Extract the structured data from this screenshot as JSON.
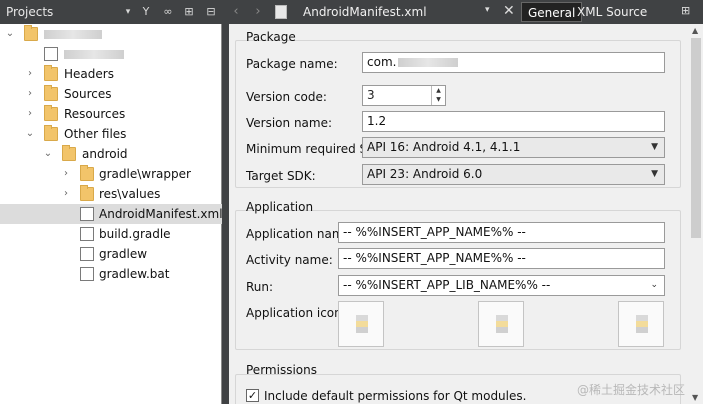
{
  "projects_pane": {
    "title": "Projects",
    "toolbar_icons": [
      "filter-icon",
      "link-icon",
      "split-icon",
      "close-pane-icon"
    ],
    "tree": {
      "root_label": "",
      "pro_file_label": "",
      "headers": "Headers",
      "sources": "Sources",
      "resources": "Resources",
      "other_files": "Other files",
      "android": "android",
      "gradle_wrapper": "gradle\\wrapper",
      "res_values": "res\\values",
      "manifest": "AndroidManifest.xml",
      "build_gradle": "build.gradle",
      "gradlew": "gradlew",
      "gradlew_bat": "gradlew.bat"
    }
  },
  "editor_tabs": {
    "document": "AndroidManifest.xml",
    "general": "General",
    "xml_source": "XML Source"
  },
  "package": {
    "title": "Package",
    "package_name_label": "Package name:",
    "package_name_value": "com.",
    "version_code_label": "Version code:",
    "version_code_value": "3",
    "version_name_label": "Version name:",
    "version_name_value": "1.2",
    "min_sdk_label": "Minimum required SDK:",
    "min_sdk_value": "API 16: Android 4.1, 4.1.1",
    "target_sdk_label": "Target SDK:",
    "target_sdk_value": "API 23: Android 6.0"
  },
  "application": {
    "title": "Application",
    "app_name_label": "Application name:",
    "app_name_value": "-- %%INSERT_APP_NAME%% --",
    "activity_name_label": "Activity name:",
    "activity_name_value": "-- %%INSERT_APP_NAME%% --",
    "run_label": "Run:",
    "run_value": "-- %%INSERT_APP_LIB_NAME%% --",
    "icon_label": "Application icon:"
  },
  "permissions": {
    "title": "Permissions",
    "include_default": "Include default permissions for Qt modules.",
    "include_default_checked": true
  },
  "watermark": "@稀土掘金技术社区"
}
